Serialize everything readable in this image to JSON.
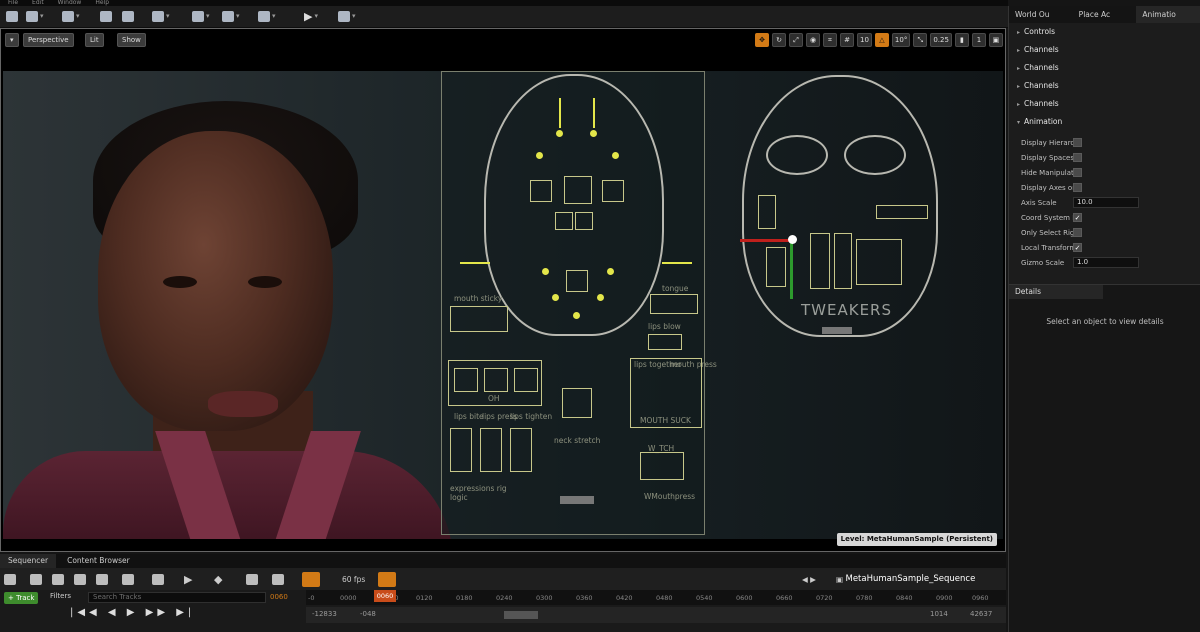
{
  "menu": [
    "File",
    "Edit",
    "Window",
    "Help"
  ],
  "viewport": {
    "perspective": "Perspective",
    "lit": "Lit",
    "show": "Show",
    "grid": "10",
    "angle": "10°",
    "scale": "0.25",
    "cams": "1",
    "level": "Level:  MetaHumanSample (Persistent)"
  },
  "rig": {
    "mouth_sticky": "mouth sticky",
    "oh": "OH",
    "tongue": "tongue",
    "lips_blow": "lips blow",
    "lips_together": "lips together",
    "mouth_press": "mouth press",
    "mouth_suck": "MOUTH SUCK",
    "lips_bite": "lips bite",
    "lips_press": "lips press",
    "lips_tighten": "lips tighten",
    "neck_stretch": "neck stretch",
    "wtch": "W_TCH",
    "expressions": "expressions rig logic",
    "wmouthpress": "WMouthpress",
    "tweakers": "TWEAKERS"
  },
  "right": {
    "tabs": [
      "World Ou",
      "Place Ac",
      "Animatio"
    ],
    "items": [
      {
        "label": "Controls"
      },
      {
        "label": "Channels"
      },
      {
        "label": "Channels"
      },
      {
        "label": "Channels"
      },
      {
        "label": "Channels"
      },
      {
        "label": "Animation"
      }
    ],
    "props": [
      {
        "label": "Display Hierarc",
        "type": "check",
        "checked": ""
      },
      {
        "label": "Display Spaces",
        "type": "check",
        "checked": ""
      },
      {
        "label": "Hide Manipulati",
        "type": "check",
        "checked": ""
      },
      {
        "label": "Display Axes or",
        "type": "check",
        "checked": ""
      },
      {
        "label": "Axis Scale",
        "type": "num",
        "value": "10.0"
      },
      {
        "label": "Coord System F",
        "type": "check",
        "checked": "✓"
      },
      {
        "label": "Only Select Rig",
        "type": "check",
        "checked": ""
      },
      {
        "label": "Local Transform",
        "type": "check",
        "checked": "✓"
      },
      {
        "label": "Gizmo Scale",
        "type": "num",
        "value": "1.0"
      }
    ],
    "details_tab": "Details",
    "details_msg": "Select an object to view details"
  },
  "bottom": {
    "tabs": [
      "Sequencer",
      "Content Browser"
    ],
    "fps": "60 fps",
    "seqname": "MetaHumanSample_Sequence",
    "track": "+ Track",
    "filters": "Filters",
    "search_ph": "Search Tracks",
    "frame": "0060",
    "playhead": "0060",
    "ticks": [
      "-0",
      "0000",
      "0060",
      "0120",
      "0180",
      "0240",
      "0300",
      "0360",
      "0420",
      "0480",
      "0540",
      "0600",
      "0660",
      "0720",
      "0780",
      "0840",
      "0900",
      "0960"
    ],
    "start": "-12833",
    "startb": "-048",
    "end1": "1014",
    "end2": "42637"
  }
}
